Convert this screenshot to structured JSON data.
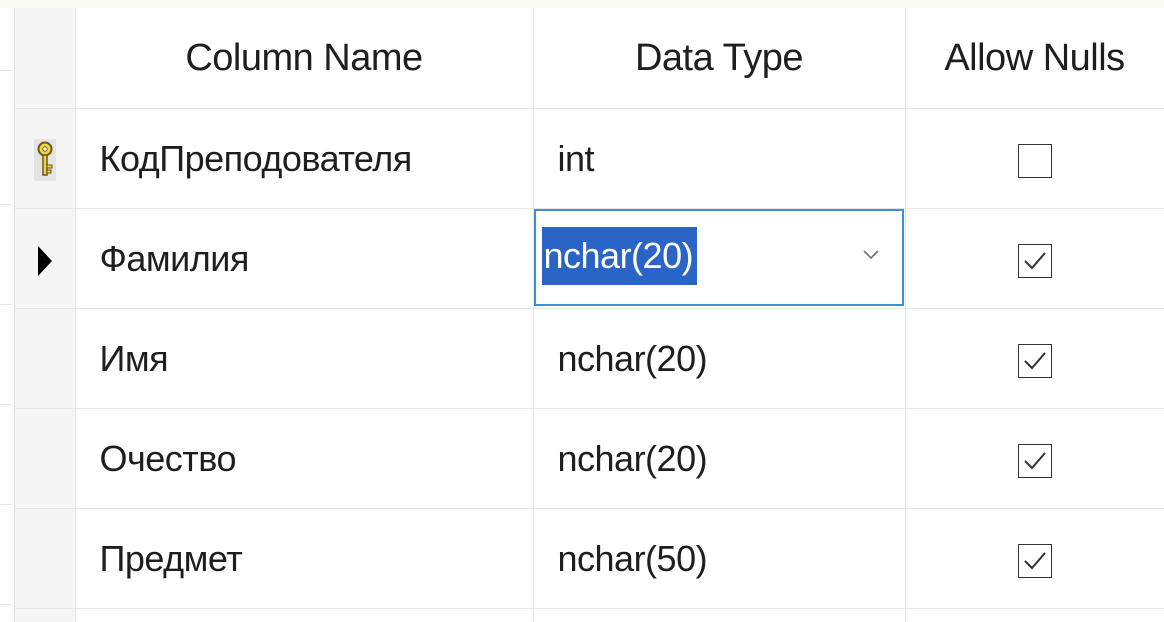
{
  "grid": {
    "headers": {
      "column_name": "Column Name",
      "data_type": "Data Type",
      "allow_nulls": "Allow Nulls"
    },
    "rows": [
      {
        "name": "КодПреподователя",
        "type": "int",
        "allow_nulls": false,
        "primary_key": true,
        "current": false
      },
      {
        "name": "Фамилия",
        "type": "nchar(20)",
        "allow_nulls": true,
        "primary_key": false,
        "current": true
      },
      {
        "name": "Имя",
        "type": "nchar(20)",
        "allow_nulls": true,
        "primary_key": false,
        "current": false
      },
      {
        "name": "Очество",
        "type": "nchar(20)",
        "allow_nulls": true,
        "primary_key": false,
        "current": false
      },
      {
        "name": "Предмет",
        "type": "nchar(50)",
        "allow_nulls": true,
        "primary_key": false,
        "current": false
      }
    ]
  },
  "icons": {
    "primary_key": "key-icon",
    "current_row": "row-pointer-icon",
    "dropdown": "chevron-down-icon",
    "checked": "checkmark-icon"
  },
  "colors": {
    "selection": "#2a64c4",
    "editor_border": "#3c8fd6",
    "key": "#e8c22b"
  }
}
